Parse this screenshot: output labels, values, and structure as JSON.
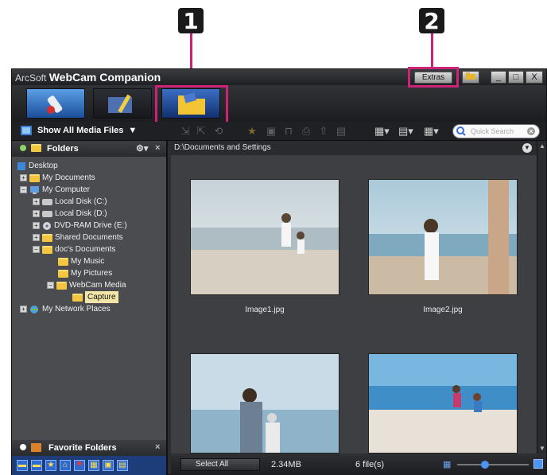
{
  "callouts": [
    {
      "number": "1"
    },
    {
      "number": "2"
    }
  ],
  "window": {
    "title_prefix": "ArcSoft",
    "title_main": "WebCam Companion",
    "extras_label": "Extras",
    "buttons": [
      "_",
      "□",
      "X"
    ]
  },
  "toolbar": {
    "show_all_label": "Show All Media Files",
    "search_placeholder": "Quick Search"
  },
  "folders_panel": {
    "title": "Folders",
    "tree": [
      {
        "label": "Desktop"
      },
      {
        "label": "My Documents"
      },
      {
        "label": "My Computer"
      },
      {
        "label": "Local Disk (C:)"
      },
      {
        "label": "Local Disk (D:)"
      },
      {
        "label": "DVD-RAM Drive (E:)"
      },
      {
        "label": "Shared Documents"
      },
      {
        "label": "doc's Documents"
      },
      {
        "label": "My Music"
      },
      {
        "label": "My Pictures"
      },
      {
        "label": "WebCam Media"
      },
      {
        "label": "Capture"
      },
      {
        "label": "My Network Places"
      }
    ]
  },
  "favorites_panel": {
    "title": "Favorite Folders"
  },
  "main": {
    "path": "D:\\Documents and Settings",
    "thumbnails": [
      {
        "label": "Image1.jpg"
      },
      {
        "label": "Image2.jpg"
      },
      {
        "label": ""
      },
      {
        "label": ""
      }
    ]
  },
  "status": {
    "select_all": "Select All",
    "size": "2.34MB",
    "count": "6 file(s)"
  },
  "colors": {
    "callout": "#cc2277",
    "accent": "#f3e5a8"
  }
}
